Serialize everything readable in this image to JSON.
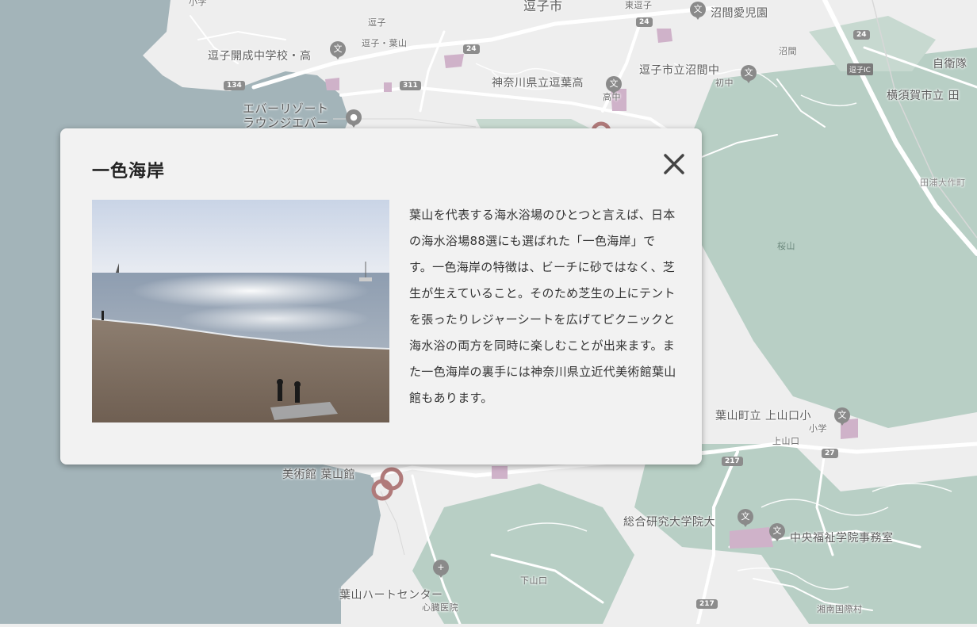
{
  "map": {
    "labels": {
      "zushi_city": "逗子市",
      "higashi_zushi": "東逗子",
      "numazu_nursery": "沼間愛児園",
      "zushi_station": "逗子",
      "zushi_hayama_station": "逗子・葉山",
      "zushi_kaisei": "逗子開成中学校・高",
      "zushi_numazu_jhs": "逗子市立沼間中",
      "junior_high_1": "初中",
      "numazu": "沼間",
      "kanagawa_zuiyo_hs": "神奈川県立逗葉高",
      "high_school_short": "高中",
      "jieitai": "自衛隊",
      "yokosuka_tau": "横須賀市立 田",
      "zushi_ic": "逗子IC",
      "tauraoosaku": "田浦大作町",
      "sakurayama": "桜山",
      "every_resort_1": "エバーリゾート",
      "every_resort_2": "ラウンジエバー",
      "hayama_kamiyamaguchi_es": "葉山町立 上山口小",
      "elementary_short": "小学",
      "kamiyamaguchi": "上山口",
      "museum_hayama": "美術館 葉山館",
      "sokendai": "総合研究大学院大",
      "chuo_fukushi": "中央福祉学院事務室",
      "shimoyamaguchi": "下山口",
      "hayama_heart_center": "葉山ハートセンター",
      "shinzo_iin": "心臓医院",
      "shonan_kokusai": "湘南国際村",
      "small_top": "小学"
    },
    "route_shields": [
      "24",
      "24",
      "24",
      "134",
      "311",
      "217",
      "27",
      "217"
    ]
  },
  "popup": {
    "title": "一色海岸",
    "description": "葉山を代表する海水浴場のひとつと言えば、日本の海水浴場88選にも選ばれた「一色海岸」です。一色海岸の特徴は、ビーチに砂ではなく、芝生が生えていること。そのため芝生の上にテントを張ったりレジャーシートを広げてピクニックと海水浴の両方を同時に楽しむことが出来ます。また一色海岸の裏手には神奈川県立近代美術館葉山館もあります。",
    "close_icon": "close-icon",
    "photo_alt": "beach-photo"
  },
  "colors": {
    "sea": "#a3b4b9",
    "land": "#eeeeee",
    "green": "#b8cfc5",
    "road": "#ffffff",
    "marker": "#b07a7a",
    "school": "#cfb2c9"
  }
}
